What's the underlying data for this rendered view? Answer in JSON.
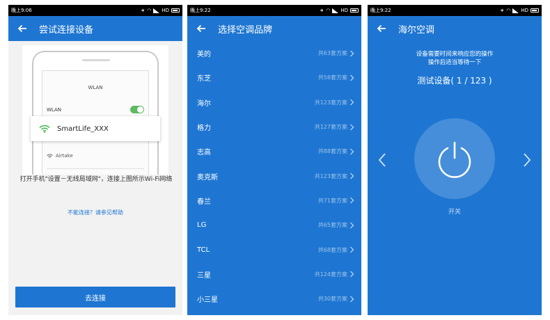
{
  "screen1": {
    "status": {
      "time": "晚上9:06",
      "right": "HD"
    },
    "title": "尝试连接设备",
    "illustration": {
      "wlan_header": "WLAN",
      "wlan_label": "WLAN",
      "network_selected": "SmartLife_XXX",
      "network_other": "Airtake"
    },
    "instruction": "打开手机\"设置－无线局域网\"，连接上图所示Wi-Fi网络",
    "help_link": "不能连接？请参见帮助",
    "connect_button": "去连接"
  },
  "screen2": {
    "status": {
      "time": "晚上9:22",
      "right": "HD"
    },
    "title": "选择空调品牌",
    "brands": [
      {
        "name": "美的",
        "count": "共63套方案"
      },
      {
        "name": "东芝",
        "count": "共58套方案"
      },
      {
        "name": "海尔",
        "count": "共123套方案"
      },
      {
        "name": "格力",
        "count": "共127套方案"
      },
      {
        "name": "志高",
        "count": "共88套方案"
      },
      {
        "name": "奥克斯",
        "count": "共123套方案"
      },
      {
        "name": "春兰",
        "count": "共71套方案"
      },
      {
        "name": "LG",
        "count": "共65套方案"
      },
      {
        "name": "TCL",
        "count": "共68套方案"
      },
      {
        "name": "三星",
        "count": "共124套方案"
      },
      {
        "name": "小三星",
        "count": "共30套方案"
      }
    ]
  },
  "screen3": {
    "status": {
      "time": "晚上9:22",
      "right": "HD"
    },
    "title": "海尔空调",
    "message_line1": "设备需要时间来响应您的操作",
    "message_line2": "操作后适当等待一下",
    "test_label": "测试设备( 1 / 123 )",
    "power_label": "开关"
  },
  "icons": [
    "back-arrow-icon",
    "wifi-icon",
    "chevron-right-icon",
    "chevron-left-icon",
    "power-icon",
    "bluetooth-icon",
    "signal-icon",
    "battery-icon"
  ],
  "colors": {
    "primary": "#1e76d2",
    "toggle_on": "#5dbb63"
  }
}
